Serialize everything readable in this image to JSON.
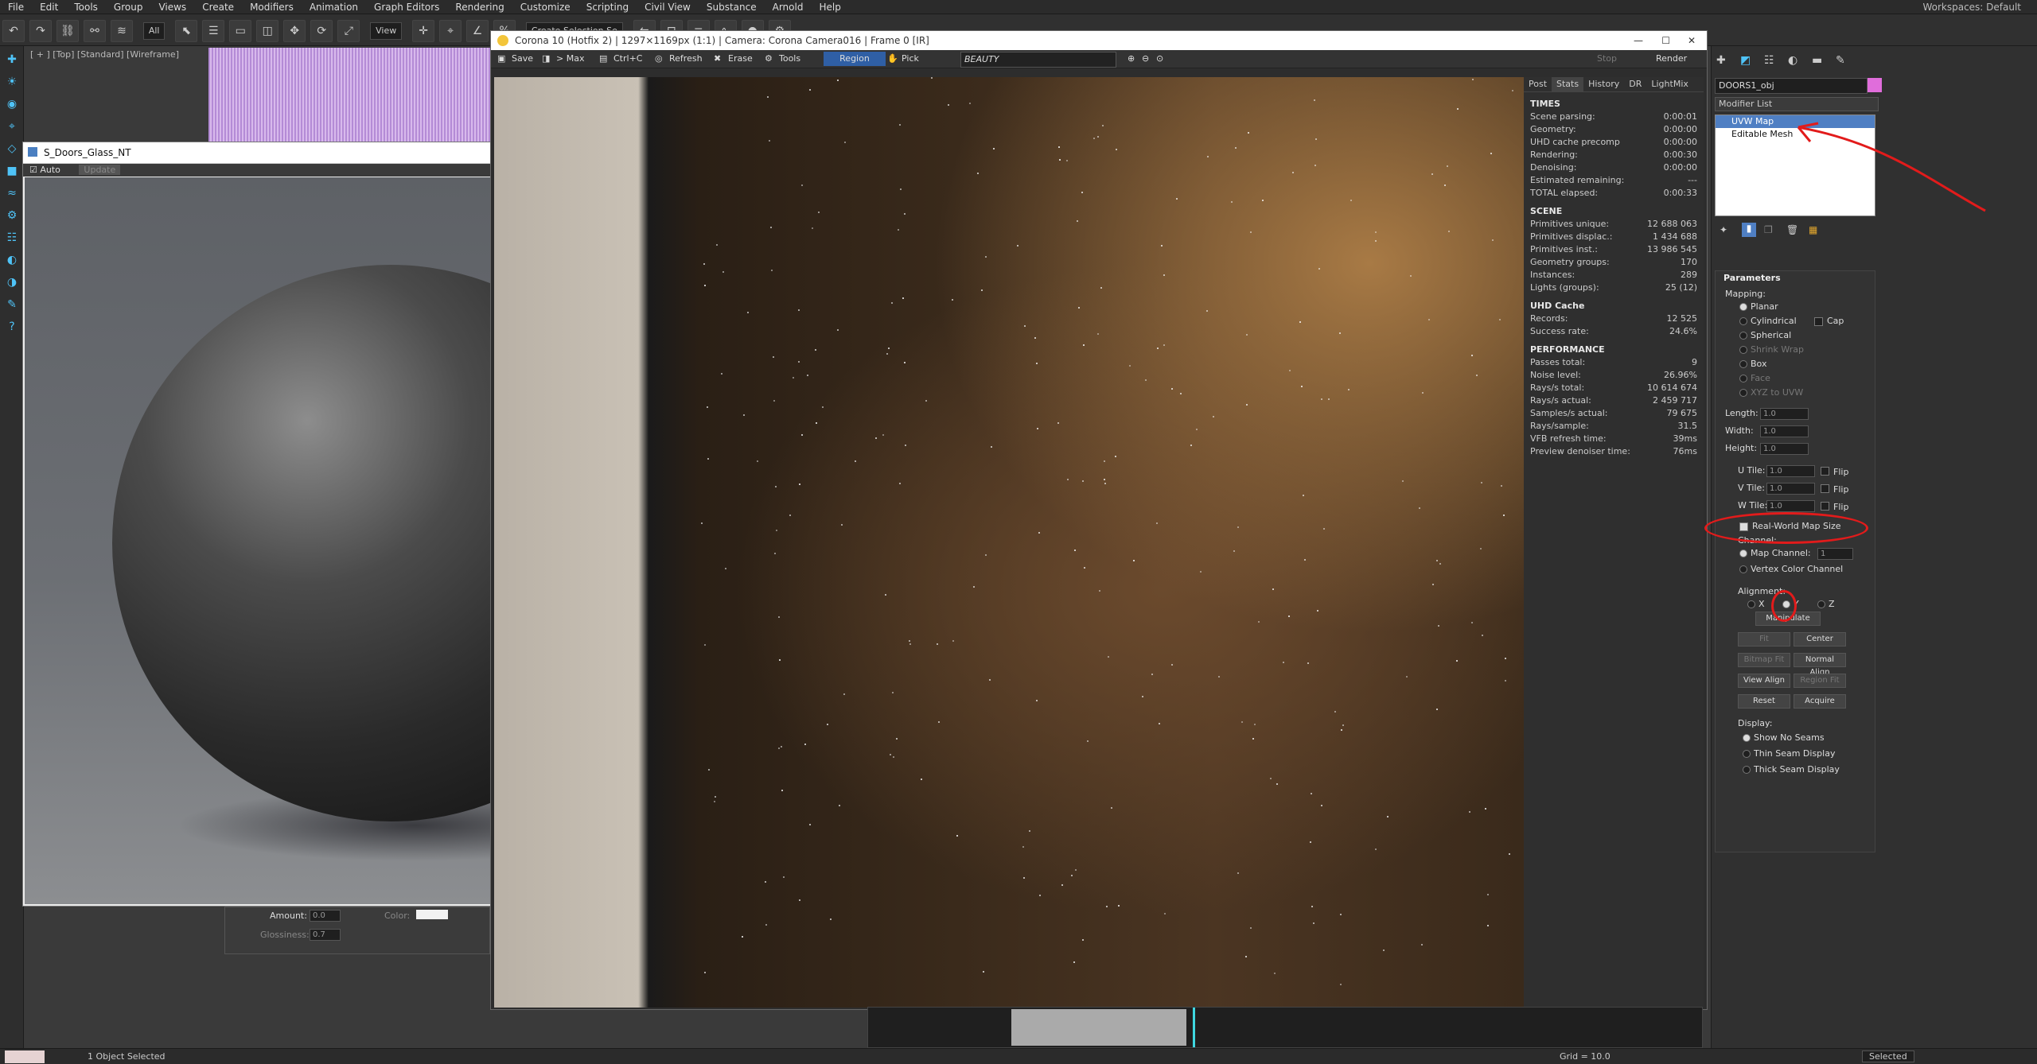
{
  "menu": [
    "File",
    "Edit",
    "Tools",
    "Group",
    "Views",
    "Create",
    "Modifiers",
    "Animation",
    "Graph Editors",
    "Rendering",
    "Customize",
    "Scripting",
    "Civil View",
    "Substance",
    "Arnold",
    "Help"
  ],
  "workspaces": "Workspaces: Default",
  "toolbar": {
    "selection_filter": "All",
    "view_combo": "View",
    "create_selection_set": "Create Selection Se"
  },
  "viewport_label": "[ + ] [Top] [Standard] [Wireframe]",
  "material_editor": {
    "title": "S_Doors_Glass_NT",
    "auto": "Auto",
    "update": "Update",
    "amount_label": "Amount:",
    "amount_value": "0.0",
    "color_label": "Color:",
    "glossiness_label": "Glossiness:",
    "glossiness_value": "0.7"
  },
  "vfb": {
    "title": "Corona 10 (Hotfix 2) | 1297×1169px (1:1) | Camera: Corona Camera016 | Frame 0 [IR]",
    "tools": {
      "save": "Save",
      "max": "> Max",
      "ctrlc": "Ctrl+C",
      "refresh": "Refresh",
      "erase": "Erase",
      "tools": "Tools",
      "region": "Region",
      "pick": "Pick",
      "beauty": "BEAUTY",
      "stop": "Stop",
      "render": "Render"
    },
    "tabs": [
      "Post",
      "Stats",
      "History",
      "DR",
      "LightMix"
    ],
    "times": {
      "header": "TIMES",
      "rows": [
        [
          "Scene parsing:",
          "0:00:01"
        ],
        [
          "Geometry:",
          "0:00:00"
        ],
        [
          "UHD cache precomp",
          "0:00:00"
        ],
        [
          "Rendering:",
          "0:00:30"
        ],
        [
          "Denoising:",
          "0:00:00"
        ],
        [
          "Estimated remaining:",
          "---"
        ],
        [
          "TOTAL elapsed:",
          "0:00:33"
        ]
      ]
    },
    "scene": {
      "header": "SCENE",
      "rows": [
        [
          "Primitives unique:",
          "12 688 063"
        ],
        [
          "Primitives displac.:",
          "1 434 688"
        ],
        [
          "Primitives inst.:",
          "13 986 545"
        ],
        [
          "Geometry groups:",
          "170"
        ],
        [
          "Instances:",
          "289"
        ],
        [
          "Lights (groups):",
          "25 (12)"
        ]
      ]
    },
    "uhd": {
      "header": "UHD Cache",
      "rows": [
        [
          "Records:",
          "12 525"
        ],
        [
          "Success rate:",
          "24.6%"
        ]
      ]
    },
    "perf": {
      "header": "PERFORMANCE",
      "rows": [
        [
          "Passes total:",
          "9"
        ],
        [
          "Noise level:",
          "26.96%"
        ],
        [
          "Rays/s total:",
          "10 614 674"
        ],
        [
          "Rays/s actual:",
          "2 459 717"
        ],
        [
          "Samples/s actual:",
          "79 675"
        ],
        [
          "Rays/sample:",
          "31.5"
        ],
        [
          "VFB refresh time:",
          "39ms"
        ],
        [
          "Preview denoiser time:",
          "76ms"
        ]
      ]
    }
  },
  "cmd": {
    "object_name": "DOORS1_obj",
    "modifier_list": "Modifier List",
    "stack": [
      "UVW Map",
      "Editable Mesh"
    ],
    "params": {
      "header": "Parameters",
      "mapping": "Mapping:",
      "planar": "Planar",
      "cylindrical": "Cylindrical",
      "cap": "Cap",
      "spherical": "Spherical",
      "shrink": "Shrink Wrap",
      "box": "Box",
      "face": "Face",
      "xyz": "XYZ to UVW",
      "length": "Length:",
      "width": "Width:",
      "height": "Height:",
      "val10": "1.0",
      "utile": "U Tile:",
      "vtile": "V Tile:",
      "wtile": "W Tile:",
      "flip": "Flip",
      "rwms": "Real-World Map Size",
      "channel": "Channel:",
      "map_channel": "Map Channel:",
      "map_channel_val": "1",
      "vertex_color": "Vertex Color Channel",
      "alignment": "Alignment:",
      "x": "X",
      "y": "Y",
      "z": "Z",
      "manipulate": "Manipulate",
      "fit": "Fit",
      "center": "Center",
      "bitmap_fit": "Bitmap Fit",
      "normal_align": "Normal Align",
      "view_align": "View Align",
      "region_fit": "Region Fit",
      "reset": "Reset",
      "acquire": "Acquire",
      "display": "Display:",
      "show_no_seams": "Show No Seams",
      "thin_seam": "Thin Seam Display",
      "thick_seam": "Thick Seam Display"
    }
  },
  "status": {
    "selected": "1 Object Selected",
    "grid": "Grid = 10.0",
    "selected_combo": "Selected"
  }
}
